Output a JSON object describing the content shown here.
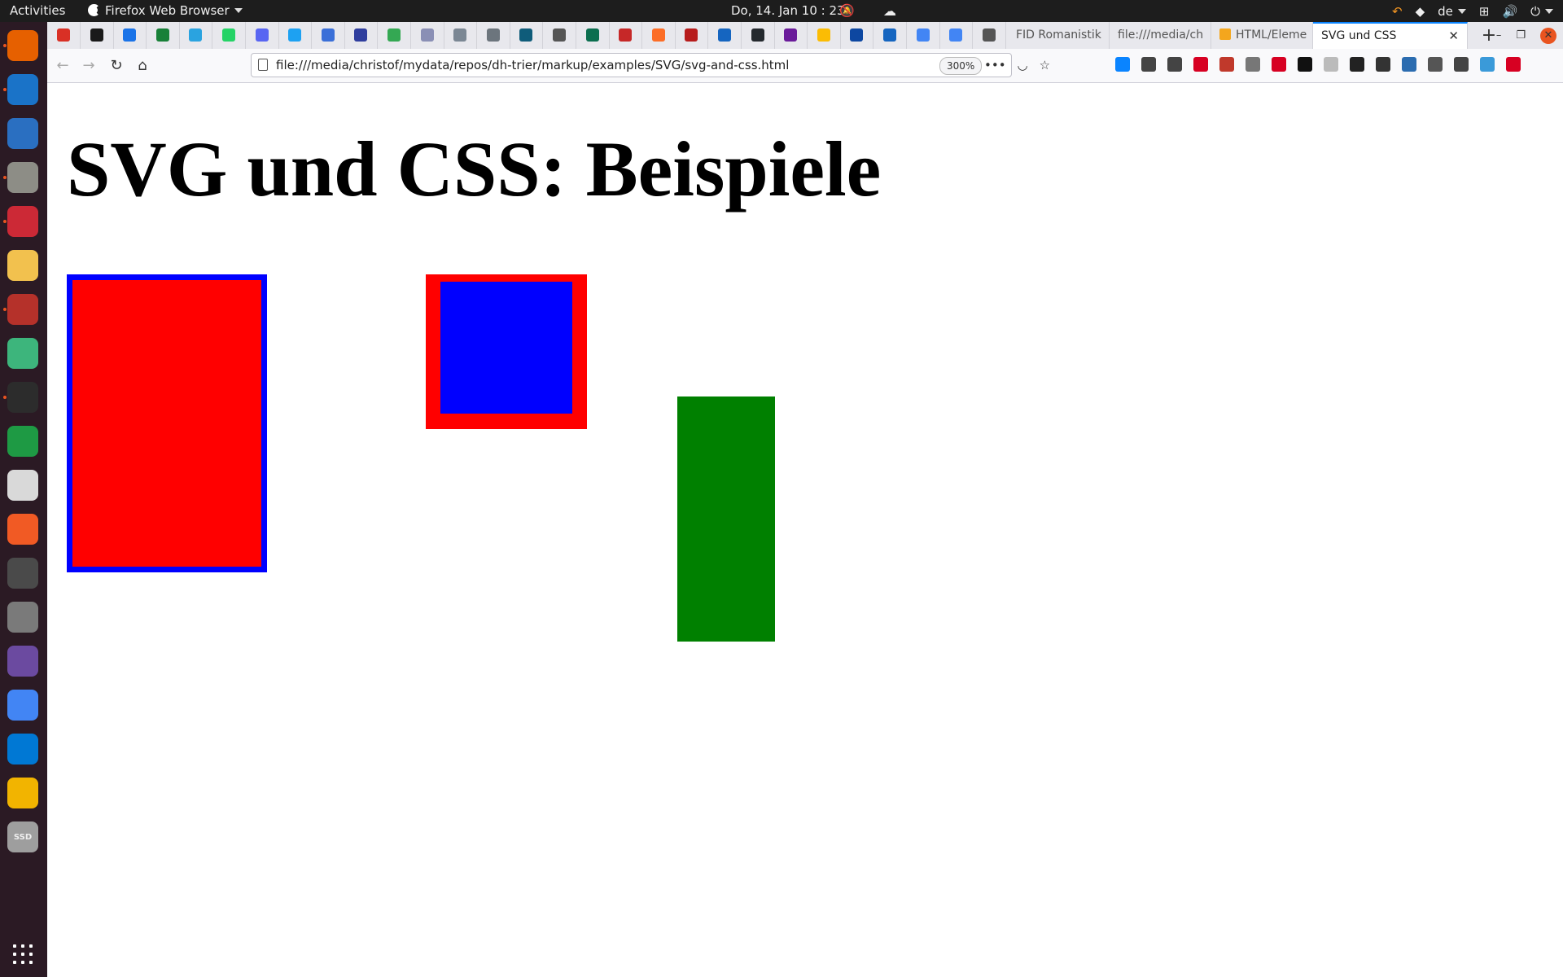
{
  "topbar": {
    "activities": "Activities",
    "app_name": "Firefox Web Browser",
    "clock": "Do, 14. Jan  10 : 23",
    "keyboard_layout": "de"
  },
  "dock": {
    "apps": [
      {
        "name": "firefox",
        "color": "#e66000",
        "running": true
      },
      {
        "name": "thunderbird",
        "color": "#1a73c8",
        "running": true
      },
      {
        "name": "libreoffice-writer",
        "color": "#2a6fc1",
        "running": false
      },
      {
        "name": "files",
        "color": "#8d8d86",
        "running": true
      },
      {
        "name": "zotero",
        "color": "#cc2936",
        "running": true
      },
      {
        "name": "python-teapot",
        "color": "#f2c14e",
        "running": false
      },
      {
        "name": "gimp-brush",
        "color": "#b5312a",
        "running": true
      },
      {
        "name": "atom-editor",
        "color": "#3db57c",
        "running": false
      },
      {
        "name": "terminal",
        "color": "#2c2c2c",
        "running": true
      },
      {
        "name": "libreoffice-calc",
        "color": "#1e9a44",
        "running": false
      },
      {
        "name": "document-viewer",
        "color": "#d9d9d9",
        "running": false
      },
      {
        "name": "brave-browser",
        "color": "#f15a24",
        "running": false
      },
      {
        "name": "software-center",
        "color": "#4a4a4a",
        "running": false
      },
      {
        "name": "scanner",
        "color": "#7a7a7a",
        "running": false
      },
      {
        "name": "video-editor",
        "color": "#6b4aa0",
        "running": false
      },
      {
        "name": "chrome",
        "color": "#4285f4",
        "running": false
      },
      {
        "name": "vscode",
        "color": "#0078d4",
        "running": false
      },
      {
        "name": "calculator",
        "color": "#f2b400",
        "running": false
      },
      {
        "name": "ssd-drive",
        "color": "#9e9e9e",
        "running": false
      }
    ],
    "ssd_label": "SSD"
  },
  "tabs": {
    "pinned": [
      {
        "name": "gmail",
        "color": "#d93025"
      },
      {
        "name": "pinned-app-2",
        "color": "#1a1a1a"
      },
      {
        "name": "calendar-14",
        "color": "#1a73e8"
      },
      {
        "name": "calendar-14b",
        "color": "#188038"
      },
      {
        "name": "telegram",
        "color": "#2aa3e0"
      },
      {
        "name": "whatsapp",
        "color": "#25d366"
      },
      {
        "name": "discord",
        "color": "#5865f2"
      },
      {
        "name": "twitter",
        "color": "#1da1f2"
      },
      {
        "name": "pinned-app-9",
        "color": "#3a6fd8"
      },
      {
        "name": "pinned-app-10",
        "color": "#2f3e9e"
      },
      {
        "name": "google-drive",
        "color": "#34a853"
      },
      {
        "name": "pinned-app-12",
        "color": "#8a8fb5"
      },
      {
        "name": "pinned-app-13",
        "color": "#7b8794"
      },
      {
        "name": "pinned-app-14",
        "color": "#6c757d"
      },
      {
        "name": "pinned-app-15",
        "color": "#0f5c7a"
      },
      {
        "name": "globe",
        "color": "#555555"
      },
      {
        "name": "pinned-app-17",
        "color": "#0b6e4f"
      },
      {
        "name": "pinned-app-18",
        "color": "#c62828"
      },
      {
        "name": "gitlab",
        "color": "#fc6d26"
      },
      {
        "name": "pinned-app-20",
        "color": "#b71c1c"
      },
      {
        "name": "pinned-app-21",
        "color": "#1565c0"
      },
      {
        "name": "github",
        "color": "#24292e"
      },
      {
        "name": "pinned-app-23",
        "color": "#6a1b9a"
      },
      {
        "name": "google-drive-2",
        "color": "#fbbc04"
      },
      {
        "name": "pinned-app-25",
        "color": "#0d47a1"
      },
      {
        "name": "pinned-app-26",
        "color": "#1565c0"
      },
      {
        "name": "google-docs",
        "color": "#4285f4"
      },
      {
        "name": "google-docs-2",
        "color": "#4285f4"
      },
      {
        "name": "globe-2",
        "color": "#555555"
      }
    ],
    "open": [
      {
        "label": "FID Romanistik",
        "active": false
      },
      {
        "label": "file:///media/ch",
        "active": false
      },
      {
        "label": "HTML/Eleme",
        "active": false
      },
      {
        "label": "SVG und CSS",
        "active": true
      }
    ],
    "new_tab": "+"
  },
  "navbar": {
    "url": "file:///media/christof/mydata/repos/dh-trier/markup/examples/SVG/svg-and-css.html",
    "zoom": "300%"
  },
  "page": {
    "title": "SVG und CSS: Beispiele",
    "shapes": [
      {
        "name": "red-rect-blue-border",
        "fill": "#ff0000",
        "stroke": "#0000ff"
      },
      {
        "name": "blue-rect-red-border",
        "fill": "#0000ff",
        "stroke": "#ff0000"
      },
      {
        "name": "green-rect",
        "fill": "#008000",
        "stroke": "none"
      }
    ]
  }
}
